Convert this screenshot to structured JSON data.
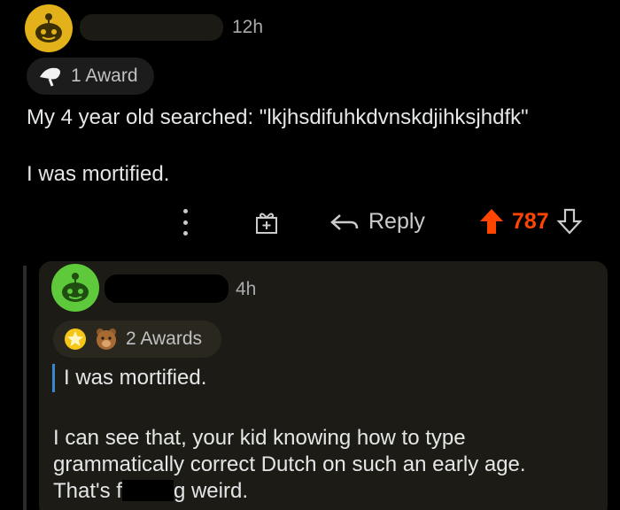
{
  "parent_comment": {
    "time": "12h",
    "awards_label": "1 Award",
    "line1": "My 4 year old searched: \"lkjhsdifuhkdvnskdjihksjhdfk\"",
    "line2": "I was mortified."
  },
  "action_bar": {
    "reply_label": "Reply",
    "score": "787"
  },
  "reply_comment": {
    "time": "4h",
    "awards_label": "2 Awards",
    "quote": "I was mortified.",
    "line1": "I can see that, your kid knowing how to type",
    "line2": "grammatically correct Dutch on such an early age.",
    "line3_before": "That's f",
    "line3_after": "g weird."
  },
  "colors": {
    "background": "#000000",
    "upvote_accent": "#ff4500",
    "quote_bar": "#3a86d1",
    "avatar_parent": "#e3b21b",
    "avatar_reply": "#5ec93a"
  },
  "icons": [
    "snoo-avatar-icon",
    "award-icon",
    "more-options-icon",
    "gift-icon",
    "reply-arrow-icon",
    "upvote-icon",
    "downvote-icon",
    "star-award-icon",
    "bear-award-icon"
  ]
}
